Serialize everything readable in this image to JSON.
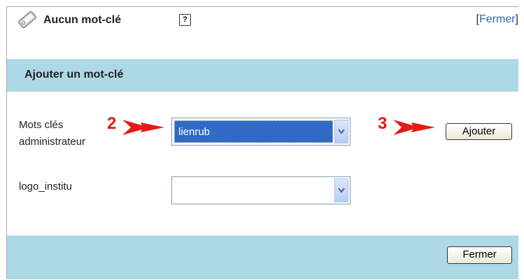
{
  "header": {
    "title": "Aucun mot-clé",
    "help_icon": "?",
    "close_link": {
      "open": "[",
      "label": "Fermer",
      "close": "]"
    }
  },
  "section": {
    "title": "Ajouter un mot-clé"
  },
  "form": {
    "row1": {
      "label": "Mots clés administrateur",
      "annotation_number": "2",
      "selected_value": "lienrub"
    },
    "annotation_button_number": "3",
    "add_button": "Ajouter",
    "row2": {
      "label": "logo_institu",
      "selected_value": ""
    }
  },
  "footer": {
    "close_button": "Fermer"
  },
  "colors": {
    "header_band": "#add8e6",
    "annotation": "#e41b17",
    "selection": "#316ac5"
  },
  "icons": [
    "tag-icon",
    "help-icon",
    "chevron-down-icon",
    "red-arrow-icon"
  ]
}
